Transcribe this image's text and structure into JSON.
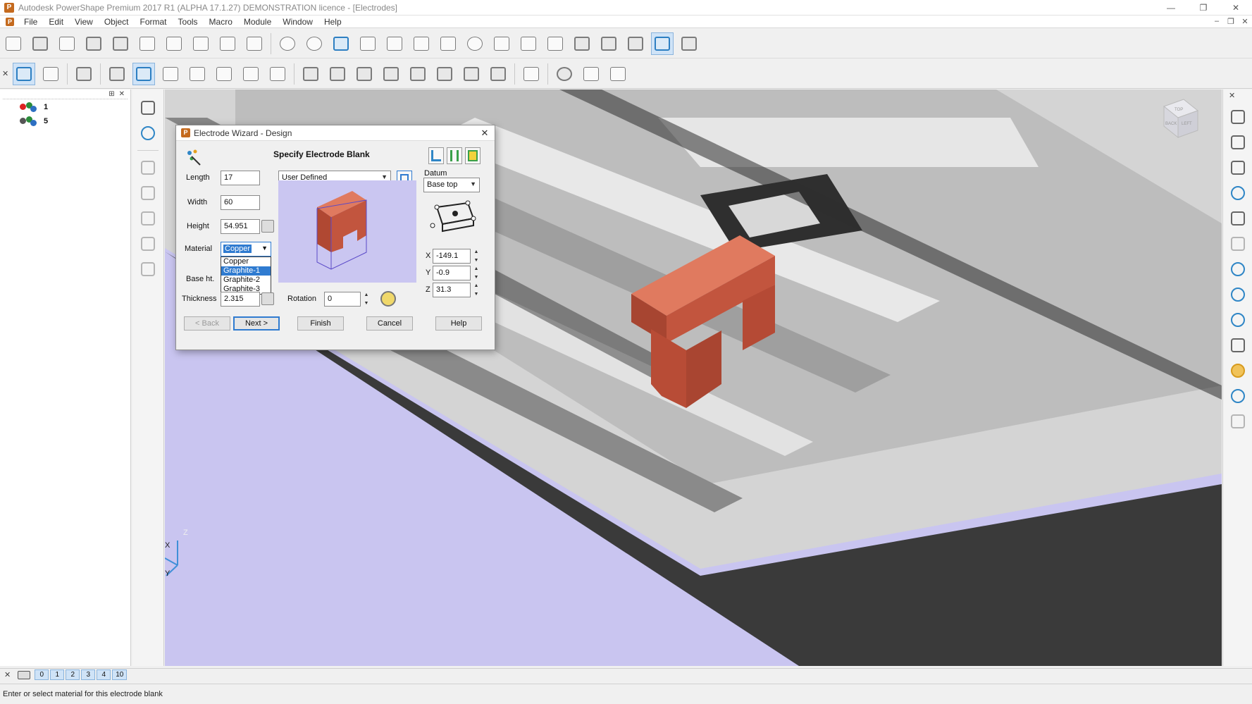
{
  "window": {
    "title": "Autodesk PowerShape Premium 2017 R1 (ALPHA 17.1.27) DEMONSTRATION licence - [Electrodes]",
    "logo_letter": "P",
    "minimize": "—",
    "maximize": "❐",
    "close": "✕"
  },
  "menu": {
    "items": [
      "File",
      "Edit",
      "View",
      "Object",
      "Format",
      "Tools",
      "Macro",
      "Module",
      "Window",
      "Help"
    ],
    "doc_minimize": "–",
    "doc_restore": "❐",
    "doc_close": "✕"
  },
  "tree": {
    "nodes": [
      {
        "label": "1"
      },
      {
        "label": "5"
      }
    ],
    "pin_glyph": "⊞",
    "close_glyph": "✕"
  },
  "layers": {
    "close_glyph": "✕",
    "numbers": [
      "0",
      "1",
      "2",
      "3",
      "4",
      "10"
    ]
  },
  "status": {
    "text": "Enter or select material for this electrode blank"
  },
  "viewport": {
    "triad": {
      "x": "X",
      "y": "Y",
      "z": "Z"
    },
    "viewcube_top": "TOP",
    "viewcube_front": "BACK",
    "viewcube_side": "LEFT",
    "colors": {
      "background": "#c9c5f0",
      "electrode": "#c2553e",
      "part_dark": "#3a3a3a",
      "part_light": "#d9d9d9"
    }
  },
  "dialog": {
    "title": "Electrode Wizard - Design",
    "logo_letter": "P",
    "close_glyph": "✕",
    "heading": "Specify Electrode Blank",
    "length_label": "Length",
    "length_value": "17",
    "width_label": "Width",
    "width_value": "60",
    "height_label": "Height",
    "height_value": "54.951",
    "material_label": "Material",
    "material_value": "Copper",
    "material_options": [
      "Copper",
      "Graphite-1",
      "Graphite-2",
      "Graphite-3"
    ],
    "material_highlighted": "Graphite-1",
    "base_ht_label": "Base ht.",
    "thickness_label": "Thickness",
    "thickness_value": "2.315",
    "blank_type": "User Defined",
    "rotation_label": "Rotation",
    "rotation_value": "0",
    "datum_label": "Datum",
    "datum_value": "Base top",
    "x_label": "X",
    "x_value": "-149.1",
    "y_label": "Y",
    "y_value": "-0.9",
    "z_label": "Z",
    "z_value": "31.3",
    "buttons": {
      "back": "< Back",
      "next": "Next >",
      "finish": "Finish",
      "cancel": "Cancel",
      "help": "Help"
    }
  }
}
